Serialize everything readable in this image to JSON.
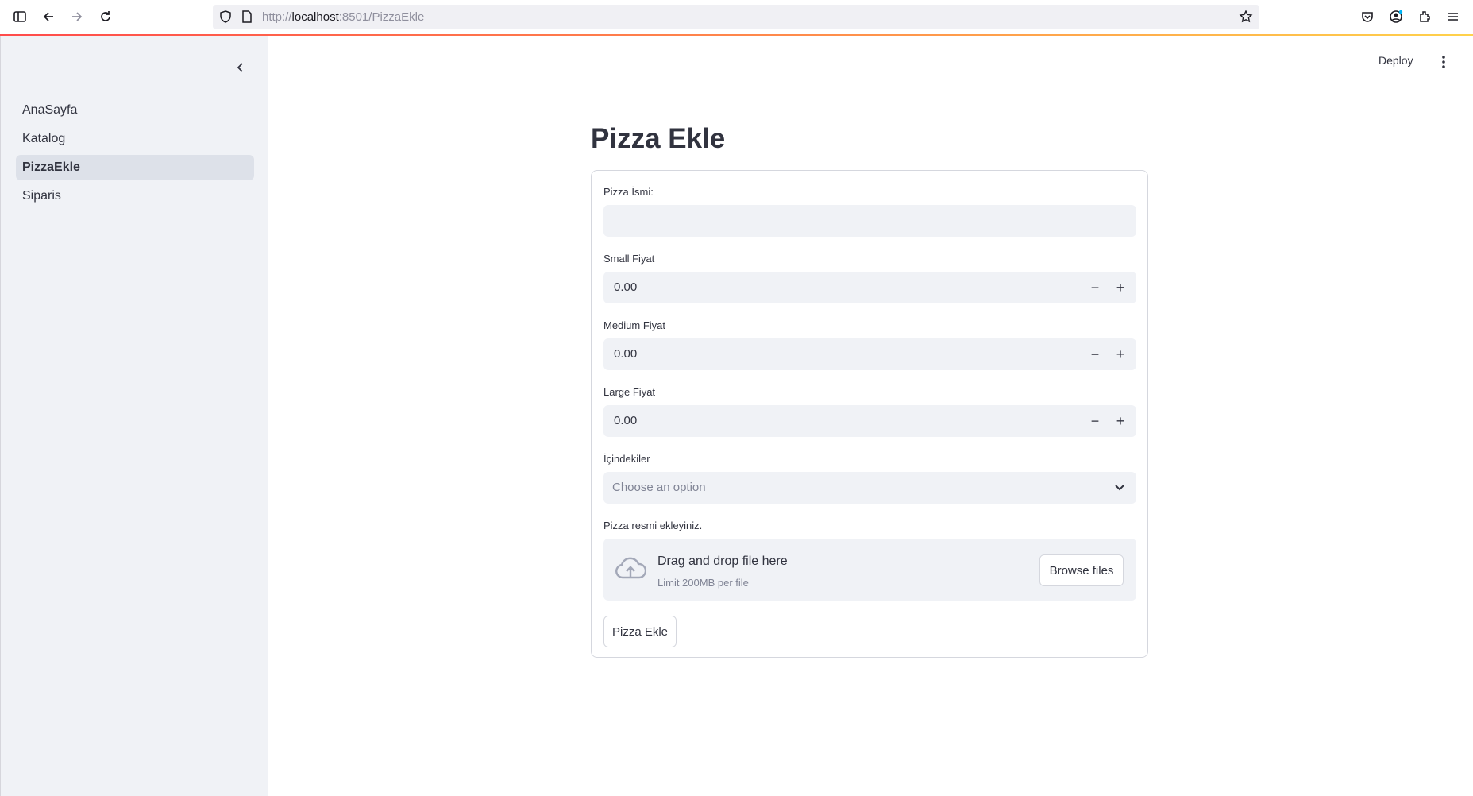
{
  "browser": {
    "url_prefix": "http://",
    "url_host": "localhost",
    "url_rest": ":8501/PizzaEkle"
  },
  "sidebar": {
    "items": [
      {
        "label": "AnaSayfa",
        "active": false
      },
      {
        "label": "Katalog",
        "active": false
      },
      {
        "label": "PizzaEkle",
        "active": true
      },
      {
        "label": "Siparis",
        "active": false
      }
    ]
  },
  "header": {
    "deploy_label": "Deploy"
  },
  "main": {
    "title": "Pizza Ekle",
    "form": {
      "name_label": "Pizza İsmi:",
      "name_value": "",
      "small_label": "Small Fiyat",
      "small_value": "0.00",
      "medium_label": "Medium Fiyat",
      "medium_value": "0.00",
      "large_label": "Large Fiyat",
      "large_value": "0.00",
      "ingredients_label": "İçindekiler",
      "ingredients_placeholder": "Choose an option",
      "image_label": "Pizza resmi ekleyiniz.",
      "dropzone_title": "Drag and drop file here",
      "dropzone_limit": "Limit 200MB per file",
      "browse_label": "Browse files",
      "submit_label": "Pizza Ekle"
    }
  },
  "colors": {
    "accent": "#ff4b4b",
    "sidebar_bg": "#f0f2f6",
    "active_item_bg": "#dde1e9"
  }
}
